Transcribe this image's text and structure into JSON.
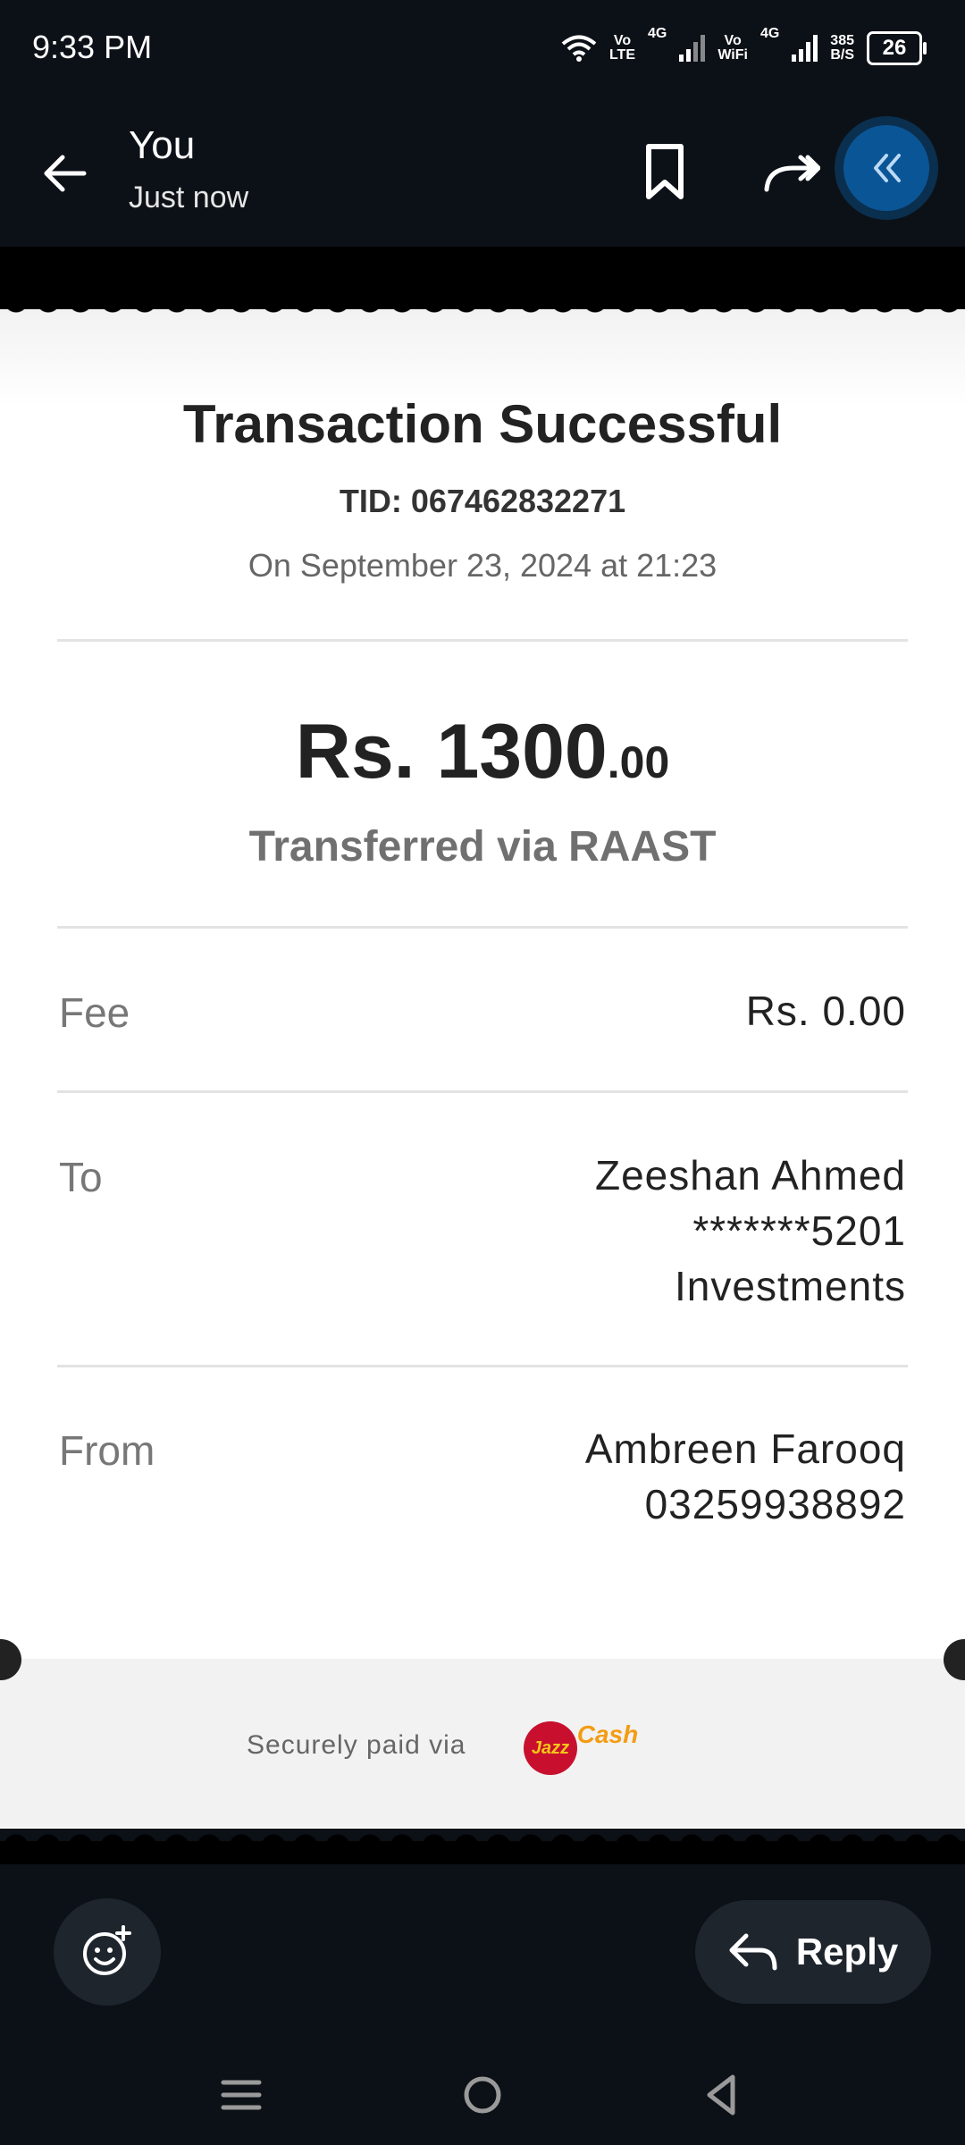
{
  "status_bar": {
    "time": "9:33 PM",
    "vo_lte_top": "Vo",
    "vo_lte_bottom": "LTE",
    "net1": "4G",
    "vo_wifi_top": "Vo",
    "vo_wifi_bottom": "WiFi",
    "net2": "4G",
    "speed_top": "385",
    "speed_bottom": "B/S",
    "battery": "26"
  },
  "header": {
    "title": "You",
    "subtitle": "Just now",
    "icons": [
      "arrow-back-icon",
      "bookmark-icon",
      "forward-icon",
      "double-chevron-left-icon"
    ]
  },
  "receipt": {
    "title": "Transaction Successful",
    "tid": "TID: 067462832271",
    "date": "On September 23, 2024 at 21:23",
    "amount_main": "Rs. 1300",
    "amount_decimal": ".00",
    "method": "Transferred via RAAST",
    "fee_label": "Fee",
    "fee_value": "Rs. 0.00",
    "to_label": "To",
    "to_lines": [
      "Zeeshan Ahmed",
      "*******5201",
      "Investments"
    ],
    "from_label": "From",
    "from_lines": [
      "Ambreen Farooq",
      "03259938892"
    ],
    "secure_text": "Securely paid via",
    "logo_text_1": "Jazz",
    "logo_text_2": "Cash"
  },
  "bottom_bar": {
    "reply_label": "Reply"
  },
  "colors": {
    "background": "#0c1117",
    "accent_button": "#0a5596",
    "logo_red": "#c8102e",
    "logo_orange": "#f39c12"
  }
}
